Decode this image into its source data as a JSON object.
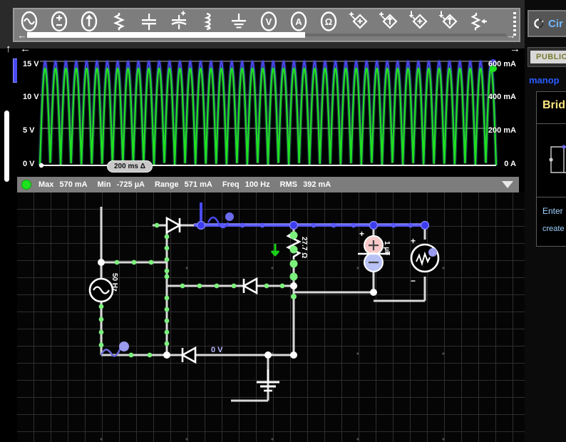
{
  "toolbar": {
    "items": [
      {
        "name": "ac-source-icon",
        "label": "AC Voltage Source"
      },
      {
        "name": "dc-source-icon",
        "label": "DC Voltage Source"
      },
      {
        "name": "current-source-icon",
        "label": "Current Source"
      },
      {
        "name": "resistor-icon",
        "label": "Resistor"
      },
      {
        "name": "capacitor-icon",
        "label": "Capacitor"
      },
      {
        "name": "polarized-capacitor-icon",
        "label": "Polarized Capacitor"
      },
      {
        "name": "inductor-icon",
        "label": "Inductor"
      },
      {
        "name": "ground-icon",
        "label": "Ground"
      },
      {
        "name": "voltmeter-icon",
        "label": "Voltmeter"
      },
      {
        "name": "ammeter-icon",
        "label": "Ammeter"
      },
      {
        "name": "ohmmeter-icon",
        "label": "Ohmmeter"
      },
      {
        "name": "vcvs-icon",
        "label": "Voltage Controlled Voltage Source"
      },
      {
        "name": "vccs-icon",
        "label": "Voltage Controlled Current Source"
      },
      {
        "name": "ccvs-icon",
        "label": "Current Controlled Voltage Source"
      },
      {
        "name": "cccs-icon",
        "label": "Current Controlled Current Source"
      },
      {
        "name": "potentiometer-icon",
        "label": "Potentiometer"
      }
    ],
    "scroll_left_arrow": "←",
    "scroll_right_arrow": "→",
    "nav_up_arrow": "↑",
    "nav_back_arrow": "←",
    "nav_forward_arrow": "→"
  },
  "scope": {
    "time_marker": "200 ms Δ",
    "y_left_labels": [
      "15 V",
      "10 V",
      "5 V",
      "0 V"
    ],
    "y_right_labels": [
      "600 mA",
      "400 mA",
      "200 mA",
      "0 A"
    ],
    "voltage_trace_color": "#4b4bf0",
    "current_trace_color": "#1fe01f",
    "status": {
      "max_key": "Max",
      "max_value": "570 mA",
      "min_key": "Min",
      "min_value": "-725 µA",
      "range_key": "Range",
      "range_value": "571 mA",
      "freq_key": "Freq",
      "freq_value": "100 Hz",
      "rms_key": "RMS",
      "rms_value": "392 mA"
    }
  },
  "chart_data": {
    "type": "line",
    "title": "",
    "xlabel": "",
    "ylabel": "",
    "x_marker": "200 ms Δ",
    "grid": true,
    "legend": "none",
    "axes": [
      {
        "side": "left",
        "unit": "V",
        "ticks": [
          0,
          5,
          10,
          15
        ],
        "tick_labels": [
          "0 V",
          "5 V",
          "10 V",
          "15 V"
        ],
        "ylim": [
          0,
          16.5
        ]
      },
      {
        "side": "right",
        "unit": "mA",
        "ticks": [
          0,
          200,
          400,
          600
        ],
        "tick_labels": [
          "0 A",
          "200 mA",
          "400 mA",
          "600 mA"
        ],
        "ylim": [
          0,
          660
        ]
      }
    ],
    "series": [
      {
        "name": "voltage",
        "color": "#4b4bf0",
        "axis": "left",
        "waveform": "full-wave-rectified-sine",
        "frequency_hz": 100,
        "peak": 15.4,
        "min": 0.0,
        "cycles_visible": 44
      },
      {
        "name": "current",
        "color": "#1fe01f",
        "axis": "right",
        "waveform": "full-wave-rectified-sine",
        "frequency_hz": 100,
        "peak": 570,
        "min": -0.725,
        "rms": 392,
        "range": 571,
        "cycles_visible": 44
      }
    ]
  },
  "circuit": {
    "components": [
      {
        "name": "ac-voltage-source",
        "label": "50 Hz"
      },
      {
        "name": "resistor",
        "label": "27.7 Ω"
      },
      {
        "name": "capacitor",
        "label": "1 µF"
      },
      {
        "name": "node-voltage",
        "label": "0 V"
      }
    ],
    "source_label": "50 Hz",
    "resistor_label": "27.7 Ω",
    "capacitor_label": "1 µF",
    "ground_node_label": "0 V",
    "cap_plus": "+",
    "scope_plus": "+",
    "scope_minus": "−",
    "wire_color": "#d8d8d8",
    "current_dot_color": "#7cf07c",
    "highlight_wire_color": "#5a5aff"
  },
  "right_panel": {
    "app_title": "Cir",
    "app_title_icon": "refresh-icon",
    "visibility_badge": "PUBLIC",
    "username": "manop",
    "circuit_name": "Brid",
    "thumbnail_alt": "circuit-thumbnail",
    "description_line1": "Enter",
    "description_line2": "create"
  }
}
